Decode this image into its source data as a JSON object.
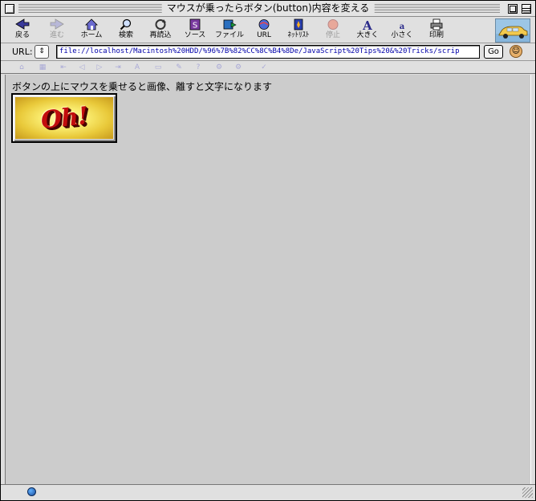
{
  "window": {
    "title": "マウスが乗ったらボタン(button)内容を変える"
  },
  "toolbar": {
    "buttons": [
      {
        "label": "戻る",
        "icon": "back-arrow-icon",
        "enabled": true
      },
      {
        "label": "進む",
        "icon": "forward-arrow-icon",
        "enabled": false
      },
      {
        "label": "ホーム",
        "icon": "home-icon",
        "enabled": true
      },
      {
        "label": "検索",
        "icon": "search-icon",
        "enabled": true
      },
      {
        "label": "再読込",
        "icon": "reload-icon",
        "enabled": true
      },
      {
        "label": "ソース",
        "icon": "source-icon",
        "enabled": true
      },
      {
        "label": "ファイル",
        "icon": "file-icon",
        "enabled": true
      },
      {
        "label": "URL",
        "icon": "url-icon",
        "enabled": true
      },
      {
        "label": "ﾈｯﾄﾘｽﾄ",
        "icon": "netlist-icon",
        "enabled": true
      },
      {
        "label": "停止",
        "icon": "stop-icon",
        "enabled": false
      },
      {
        "label": "大きく",
        "icon": "font-larger-icon",
        "enabled": true
      },
      {
        "label": "小さく",
        "icon": "font-smaller-icon",
        "enabled": true
      },
      {
        "label": "印刷",
        "icon": "print-icon",
        "enabled": true
      }
    ]
  },
  "location": {
    "label": "URL:",
    "value": "file://localhost/Macintosh%20HDD/%96%7B%82%CC%8C%B4%8De/JavaScript%20Tips%20&%20Tricks/scrip",
    "go_label": "Go"
  },
  "content": {
    "message": "ボタンの上にマウスを乗せると画像、離すと文字になります",
    "button_image_text": "Oh!"
  }
}
